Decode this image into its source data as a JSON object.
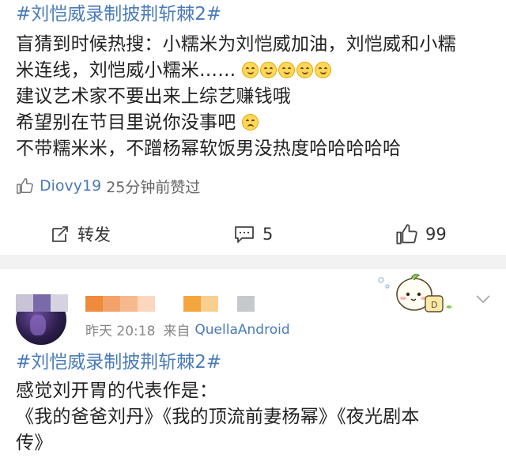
{
  "post1": {
    "hashtag": "#刘恺威录制披荆斩棘2#",
    "lines": [
      "盲猜到时候热搜：小糯米为刘恺威加油，刘恺威和小糯",
      "米连线，刘恺威小糯米……",
      "建议艺术家不要出来上综艺赚钱哦",
      "希望别在节目里说你没事吧",
      "不带糯米米，不蹭杨幂软饭男没热度哈哈哈哈哈"
    ],
    "emoji_count": 5,
    "liked_by": {
      "name": "Diovy19",
      "note": "25分钟前赞过"
    },
    "actions": {
      "repost_label": "转发",
      "comment_count": "5",
      "like_count": "99"
    }
  },
  "post2": {
    "meta_time": "昨天 20:18",
    "meta_from": "来自",
    "meta_source": "QuellaAndroid",
    "hashtag": "#刘恺威录制披荆斩棘2#",
    "lines": [
      "感觉刘开胃的代表作是：",
      "《我的爸爸刘丹》《我的顶流前妻杨幂》《夜光剧本",
      "传》"
    ]
  },
  "colors": {
    "link_blue": "#4a7bb8",
    "separator": "#f2f2f2",
    "text": "#222222",
    "meta_gray": "#888888"
  },
  "icons": [
    "thumb-up-icon",
    "repost-icon",
    "comment-icon",
    "chevron-down-icon",
    "sticker-icon"
  ]
}
